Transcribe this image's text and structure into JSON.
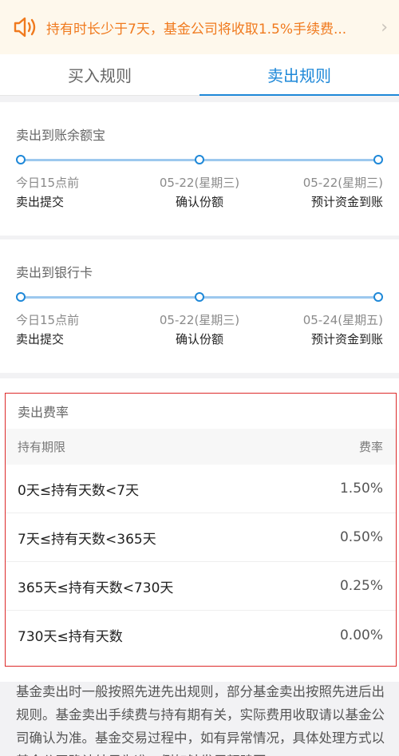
{
  "notice": {
    "icon": "speaker-icon",
    "text": "持有时长少于7天，基金公司将收取1.5%手续费...",
    "chevron": "›"
  },
  "tabs": [
    {
      "label": "买入规则",
      "active": false
    },
    {
      "label": "卖出规则",
      "active": true
    }
  ],
  "sell_to_balance": {
    "title": "卖出到账余额宝",
    "steps": [
      {
        "date": "今日15点前",
        "label": "卖出提交"
      },
      {
        "date": "05-22(星期三)",
        "label": "确认份额"
      },
      {
        "date": "05-22(星期三)",
        "label": "预计资金到账"
      }
    ]
  },
  "sell_to_bank": {
    "title": "卖出到银行卡",
    "steps": [
      {
        "date": "今日15点前",
        "label": "卖出提交"
      },
      {
        "date": "05-22(星期三)",
        "label": "确认份额"
      },
      {
        "date": "05-24(星期五)",
        "label": "预计资金到账"
      }
    ]
  },
  "fee": {
    "title": "卖出费率",
    "header": {
      "period": "持有期限",
      "rate": "费率"
    },
    "rows": [
      {
        "period": "0天≤持有天数<7天",
        "rate": "1.50%"
      },
      {
        "period": "7天≤持有天数<365天",
        "rate": "0.50%"
      },
      {
        "period": "365天≤持有天数<730天",
        "rate": "0.25%"
      },
      {
        "period": "730天≤持有天数",
        "rate": "0.00%"
      }
    ]
  },
  "footer": {
    "text": "基金卖出时一般按照先进先出规则，部分基金卖出按照先进后出规则。基金卖出手续费与持有期有关，实际费用收取请以基金公司确认为准。基金交易过程中，如有异常情况，具体处理方式以基金公司确认结果为准。例如触发巨额赎回"
  },
  "colors": {
    "accent": "#1e88d8",
    "notice_text": "#f07a1e",
    "notice_bg": "#fef8ec",
    "highlight_border": "#dd2a2a"
  }
}
